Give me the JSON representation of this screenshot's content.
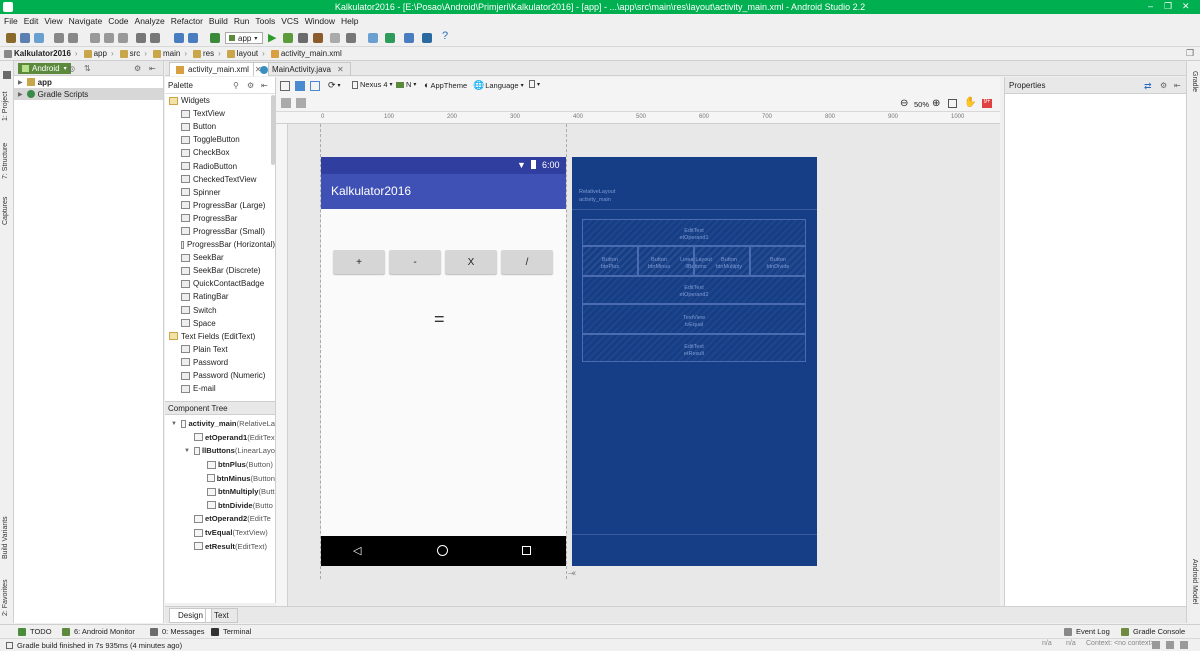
{
  "window": {
    "title": "Kalkulator2016 - [E:\\Posao\\Android\\Primjeri\\Kalkulator2016] - [app] - ...\\app\\src\\main\\res\\layout\\activity_main.xml - Android Studio 2.2"
  },
  "menu": [
    "File",
    "Edit",
    "View",
    "Navigate",
    "Code",
    "Analyze",
    "Refactor",
    "Build",
    "Run",
    "Tools",
    "VCS",
    "Window",
    "Help"
  ],
  "toolbar": {
    "run_config": "app"
  },
  "breadcrumbs": [
    "Kalkulator2016",
    "app",
    "src",
    "main",
    "res",
    "layout",
    "activity_main.xml"
  ],
  "side_left": [
    "1: Project",
    "7: Structure",
    "Captures",
    "Build Variants",
    "2: Favorites"
  ],
  "side_right": [
    "Gradle",
    "Android Model"
  ],
  "project": {
    "view_mode": "Android",
    "items": [
      {
        "label": "app",
        "bold": true
      },
      {
        "label": "Gradle Scripts",
        "bold": false
      }
    ]
  },
  "editor_tabs": [
    {
      "label": "activity_main.xml",
      "active": true
    },
    {
      "label": "MainActivity.java",
      "active": false
    }
  ],
  "palette": {
    "title": "Palette",
    "items": [
      {
        "label": "Widgets",
        "kind": "folder"
      },
      {
        "label": "TextView",
        "kind": "item"
      },
      {
        "label": "Button",
        "kind": "item"
      },
      {
        "label": "ToggleButton",
        "kind": "item"
      },
      {
        "label": "CheckBox",
        "kind": "item"
      },
      {
        "label": "RadioButton",
        "kind": "item"
      },
      {
        "label": "CheckedTextView",
        "kind": "item"
      },
      {
        "label": "Spinner",
        "kind": "item"
      },
      {
        "label": "ProgressBar (Large)",
        "kind": "item"
      },
      {
        "label": "ProgressBar",
        "kind": "item"
      },
      {
        "label": "ProgressBar (Small)",
        "kind": "item"
      },
      {
        "label": "ProgressBar (Horizontal)",
        "kind": "item"
      },
      {
        "label": "SeekBar",
        "kind": "item"
      },
      {
        "label": "SeekBar (Discrete)",
        "kind": "item"
      },
      {
        "label": "QuickContactBadge",
        "kind": "item"
      },
      {
        "label": "RatingBar",
        "kind": "item"
      },
      {
        "label": "Switch",
        "kind": "item"
      },
      {
        "label": "Space",
        "kind": "item"
      },
      {
        "label": "Text Fields (EditText)",
        "kind": "folder"
      },
      {
        "label": "Plain Text",
        "kind": "item"
      },
      {
        "label": "Password",
        "kind": "item"
      },
      {
        "label": "Password (Numeric)",
        "kind": "item"
      },
      {
        "label": "E-mail",
        "kind": "item"
      }
    ]
  },
  "component_tree": {
    "title": "Component Tree",
    "rows": [
      {
        "name": "activity_main",
        "type": " (RelativeLa",
        "level": 0
      },
      {
        "name": "etOperand1",
        "type": " (EditTex",
        "level": 1
      },
      {
        "name": "llButtons",
        "type": " (LinearLayo",
        "level": 1
      },
      {
        "name": "btnPlus",
        "type": " (Button)",
        "level": 2
      },
      {
        "name": "btnMinus",
        "type": " (Button",
        "level": 2
      },
      {
        "name": "btnMultiply",
        "type": " (Butt",
        "level": 2
      },
      {
        "name": "btnDivide",
        "type": " (Butto",
        "level": 2
      },
      {
        "name": "etOperand2",
        "type": " (EditTe",
        "level": 1
      },
      {
        "name": "tvEqual",
        "type": " (TextView)",
        "level": 1
      },
      {
        "name": "etResult",
        "type": " (EditText)",
        "level": 1
      }
    ]
  },
  "design_toolbar": {
    "device": "Nexus 4",
    "api": "N",
    "theme": "AppTheme",
    "language": "Language",
    "zoom": "50%"
  },
  "ruler_marks": [
    "0",
    "100",
    "200",
    "300",
    "400",
    "500",
    "600",
    "700",
    "800",
    "900",
    "1000"
  ],
  "phone": {
    "time": "6:00",
    "app_title": "Kalkulator2016",
    "buttons": [
      "+",
      "-",
      "X",
      "/"
    ],
    "equal": "="
  },
  "blueprint": {
    "root_type": "RelativeLayout",
    "root_id": "activity_main",
    "boxes": [
      {
        "type": "EditText",
        "id": "etOperand1"
      },
      {
        "type": "Button",
        "id": "btnPlus"
      },
      {
        "type": "Button",
        "id": "btnMinus"
      },
      {
        "type": "LinearLayout",
        "id": "llButtons"
      },
      {
        "type": "Button",
        "id": "btnMultiply"
      },
      {
        "type": "Button",
        "id": "btnDivide"
      },
      {
        "type": "EditText",
        "id": "etOperand2"
      },
      {
        "type": "TextView",
        "id": "tvEqual"
      },
      {
        "type": "EditText",
        "id": "etResult"
      }
    ]
  },
  "properties": {
    "title": "Properties"
  },
  "bottom_tabs": [
    {
      "label": "Design",
      "active": true
    },
    {
      "label": "Text",
      "active": false
    }
  ],
  "tool_windows": [
    {
      "label": "TODO",
      "color": "#4a8c3a"
    },
    {
      "label": "6: Android Monitor",
      "color": "#5b8a3c"
    },
    {
      "label": "0: Messages",
      "color": "#6b6b6b"
    },
    {
      "label": "Terminal",
      "color": "#333333"
    }
  ],
  "tool_windows_right": [
    {
      "label": "Event Log",
      "color": "#888888"
    },
    {
      "label": "Gradle Console",
      "color": "#6f8b3f"
    }
  ],
  "status": {
    "message": "Gradle build finished in 7s 935ms (4 minutes ago)",
    "right": [
      "n/a",
      "n/a",
      "Context: <no context>"
    ]
  },
  "colors": {
    "title_bar": "#00b050",
    "primary": "#3f51b5",
    "primary_dark": "#303f9f",
    "blueprint": "#163e86",
    "android_badge": "#5b8a3c"
  }
}
